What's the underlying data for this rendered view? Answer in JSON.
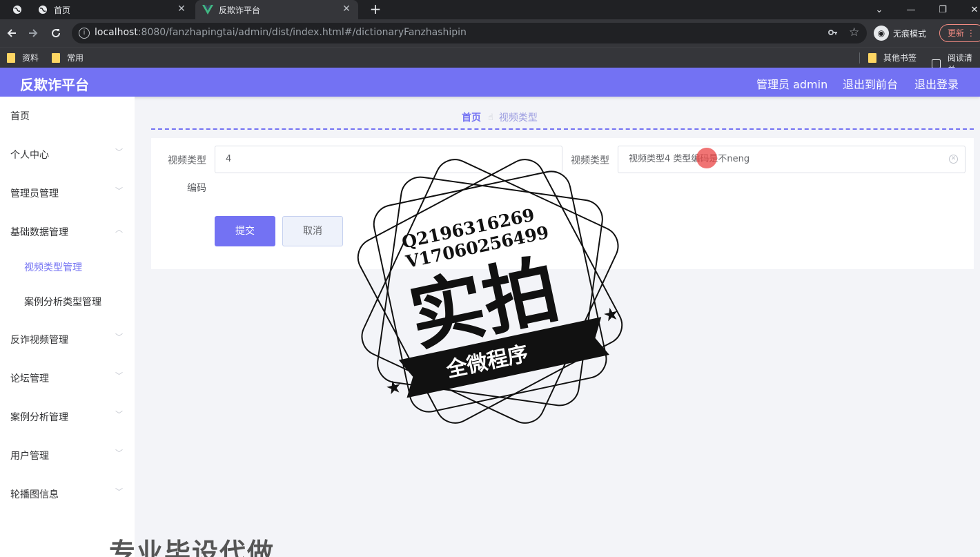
{
  "browser": {
    "tabs": [
      {
        "label": ""
      },
      {
        "label": "首页"
      },
      {
        "label": "反欺诈平台"
      }
    ],
    "address": {
      "host": "localhost",
      "rest": ":8080/fanzhapingtai/admin/dist/index.html#/dictionaryFanzhashipin"
    },
    "incognito_label": "无痕模式",
    "update_label": "更新",
    "bookmarks": {
      "left": [
        {
          "label": "资料"
        },
        {
          "label": "常用"
        }
      ],
      "other": "其他书签",
      "reading": "阅读清单"
    },
    "icons": {
      "back": "back-arrow-icon",
      "forward": "forward-arrow-icon",
      "reload": "reload-icon",
      "star": "star-icon",
      "key": "key-icon"
    }
  },
  "app": {
    "title": "反欺诈平台",
    "header_links": {
      "admin": "管理员 admin",
      "to_front": "退出到前台",
      "logout": "退出登录"
    },
    "accent": "#7372f3"
  },
  "sidebar": {
    "items": [
      {
        "label": "首页"
      },
      {
        "label": "个人中心"
      },
      {
        "label": "管理员管理"
      },
      {
        "label": "基础数据管理"
      },
      {
        "label": "反诈视频管理"
      },
      {
        "label": "论坛管理"
      },
      {
        "label": "案例分析管理"
      },
      {
        "label": "用户管理"
      },
      {
        "label": "轮播图信息"
      }
    ],
    "subitems": [
      {
        "label": "视频类型管理"
      },
      {
        "label": "案例分析类型管理"
      }
    ]
  },
  "breadcrumb": {
    "home": "首页",
    "current": "视频类型"
  },
  "form": {
    "code_label_line1": "视频类型",
    "code_label_line2": "编码",
    "code_value": "4",
    "type_label": "视频类型",
    "type_value": "视频类型4 类型编码是不neng",
    "submit": "提交",
    "cancel": "取消"
  },
  "watermark": {
    "line1": "Q2196316269",
    "line2": "V17060256499",
    "main": "实拍",
    "banner": "全微程序",
    "bottom": "专业毕设代做"
  }
}
